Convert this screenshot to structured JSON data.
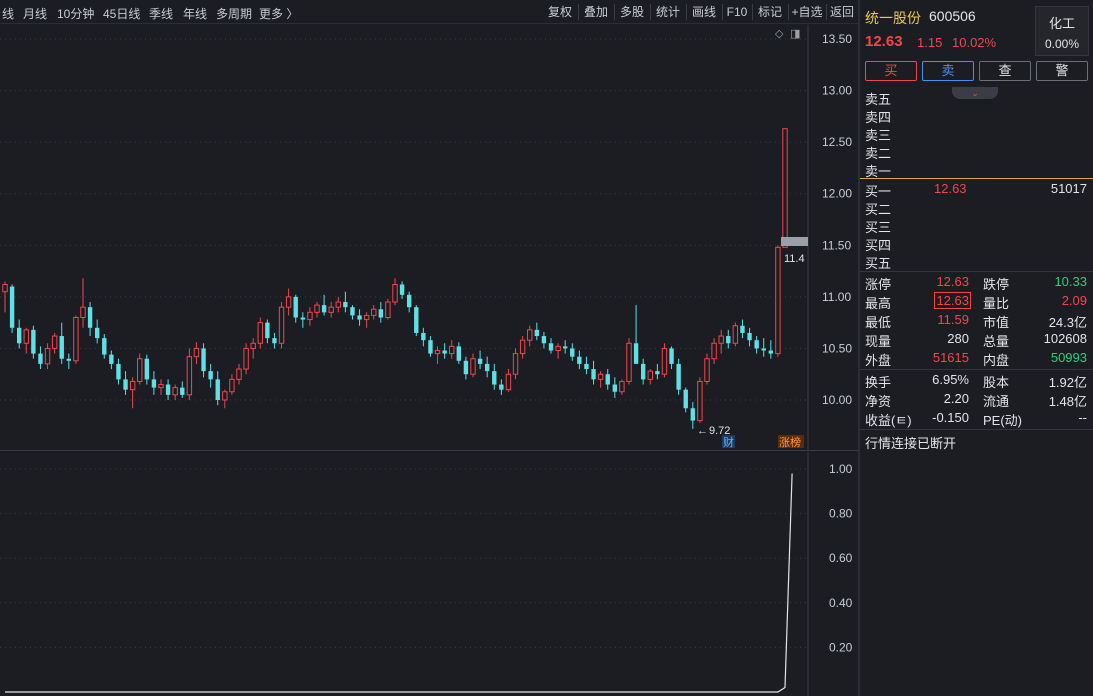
{
  "toolbar": {
    "period_tabs": [
      "线",
      "月线",
      "10分钟",
      "45日线",
      "季线",
      "年线",
      "多周期",
      "更多 〉"
    ],
    "buttons": [
      "复权",
      "叠加",
      "多股",
      "统计",
      "画线",
      "F10",
      "标记",
      "+自选",
      "返回"
    ]
  },
  "chart_icons": {
    "diamond": "◇",
    "toggle": "◨"
  },
  "price_axis": {
    "labels": [
      "13.50",
      "13.00",
      "12.50",
      "12.00",
      "11.50",
      "11.00",
      "10.50",
      "10.00"
    ],
    "current_tag": "11.4",
    "low_marker": "9.72",
    "cai_label": "财",
    "zhangbang_label": "涨榜"
  },
  "volume_axis": {
    "labels": [
      "1.00",
      "0.80",
      "0.60",
      "0.40",
      "0.20"
    ]
  },
  "stock": {
    "name": "统一股份",
    "code": "600506",
    "price": "12.63",
    "change": "1.15",
    "change_pct": "10.02%",
    "sector": "化工",
    "sector_change": "0.00%"
  },
  "trade_buttons": [
    {
      "label": "买",
      "color": "#f0474d",
      "border": "#f0474d"
    },
    {
      "label": "卖",
      "color": "#4d8df0",
      "border": "#4d8df0"
    },
    {
      "label": "查",
      "color": "#e2e4e8",
      "border": "#6a6e77"
    },
    {
      "label": "警",
      "color": "#e2e4e8",
      "border": "#6a6e77"
    }
  ],
  "collapse_icon": "⌄",
  "order_book": {
    "asks": [
      {
        "label": "卖五",
        "price": "",
        "volume": ""
      },
      {
        "label": "卖四",
        "price": "",
        "volume": ""
      },
      {
        "label": "卖三",
        "price": "",
        "volume": ""
      },
      {
        "label": "卖二",
        "price": "",
        "volume": ""
      },
      {
        "label": "卖一",
        "price": "",
        "volume": ""
      }
    ],
    "bids": [
      {
        "label": "买一",
        "price": "12.63",
        "volume": "51017"
      },
      {
        "label": "买二",
        "price": "",
        "volume": ""
      },
      {
        "label": "买三",
        "price": "",
        "volume": ""
      },
      {
        "label": "买四",
        "price": "",
        "volume": ""
      },
      {
        "label": "买五",
        "price": "",
        "volume": ""
      }
    ]
  },
  "quotes": [
    {
      "l1": "涨停",
      "v1": "12.63",
      "c1": "red",
      "l2": "跌停",
      "v2": "10.33",
      "c2": "green"
    },
    {
      "l1": "最高",
      "v1": "12.63",
      "c1": "red",
      "l2": "量比",
      "v2": "2.09",
      "c2": "red"
    },
    {
      "l1": "最低",
      "v1": "11.59",
      "c1": "red",
      "l2": "市值",
      "v2": "24.3亿",
      "c2": "white"
    },
    {
      "l1": "现量",
      "v1": "280",
      "c1": "white",
      "l2": "总量",
      "v2": "102608",
      "c2": "white"
    },
    {
      "l1": "外盘",
      "v1": "51615",
      "c1": "red",
      "l2": "内盘",
      "v2": "50993",
      "c2": "green"
    }
  ],
  "fundamentals": [
    {
      "l1": "换手",
      "v1": "6.95%",
      "l2": "股本",
      "v2": "1.92亿"
    },
    {
      "l1": "净资",
      "v1": "2.20",
      "l2": "流通",
      "v2": "1.48亿"
    },
    {
      "l1": "收益(ㅌ)",
      "v1": "-0.150",
      "l2": "PE(动)",
      "v2": "--"
    }
  ],
  "status": "行情连接已断开",
  "colors": {
    "up": "#f0474d",
    "down": "#5ee0e6",
    "bg": "#1b1d22",
    "axis_text": "#c8ccd4",
    "grid": "#3a3d45"
  },
  "chart_data": {
    "type": "candlestick",
    "y_axis_main": {
      "range": [
        9.72,
        13.5
      ],
      "ticks": [
        13.5,
        13.0,
        12.5,
        12.0,
        11.5,
        11.0,
        10.5,
        10.0
      ]
    },
    "y_axis_sub": {
      "range": [
        0,
        1.0
      ],
      "ticks": [
        1.0,
        0.8,
        0.6,
        0.4,
        0.2
      ]
    },
    "last_close": 12.63,
    "previous_close": 11.48,
    "low_marked": 9.72,
    "candles_ohlc": [
      [
        11.05,
        11.15,
        10.85,
        11.12
      ],
      [
        11.1,
        11.12,
        10.65,
        10.7
      ],
      [
        10.7,
        10.78,
        10.5,
        10.55
      ],
      [
        10.55,
        10.7,
        10.45,
        10.68
      ],
      [
        10.68,
        10.72,
        10.4,
        10.45
      ],
      [
        10.45,
        10.52,
        10.3,
        10.35
      ],
      [
        10.35,
        10.55,
        10.3,
        10.5
      ],
      [
        10.5,
        10.65,
        10.45,
        10.62
      ],
      [
        10.62,
        10.75,
        10.35,
        10.4
      ],
      [
        10.4,
        10.45,
        10.3,
        10.38
      ],
      [
        10.38,
        10.82,
        10.35,
        10.8
      ],
      [
        10.8,
        11.18,
        10.7,
        10.9
      ],
      [
        10.9,
        10.95,
        10.62,
        10.7
      ],
      [
        10.7,
        10.78,
        10.55,
        10.6
      ],
      [
        10.6,
        10.64,
        10.4,
        10.44
      ],
      [
        10.44,
        10.48,
        10.3,
        10.35
      ],
      [
        10.35,
        10.4,
        10.15,
        10.2
      ],
      [
        10.2,
        10.28,
        10.05,
        10.1
      ],
      [
        10.1,
        10.22,
        9.92,
        10.18
      ],
      [
        10.18,
        10.45,
        10.15,
        10.4
      ],
      [
        10.4,
        10.44,
        10.15,
        10.2
      ],
      [
        10.2,
        10.28,
        10.05,
        10.12
      ],
      [
        10.12,
        10.2,
        10.05,
        10.15
      ],
      [
        10.15,
        10.2,
        10.0,
        10.05
      ],
      [
        10.05,
        10.15,
        10.0,
        10.12
      ],
      [
        10.12,
        10.18,
        10.02,
        10.05
      ],
      [
        10.05,
        10.5,
        10.0,
        10.42
      ],
      [
        10.42,
        10.56,
        10.35,
        10.5
      ],
      [
        10.5,
        10.55,
        10.22,
        10.28
      ],
      [
        10.28,
        10.35,
        10.12,
        10.2
      ],
      [
        10.2,
        10.28,
        9.95,
        10.0
      ],
      [
        10.0,
        10.1,
        9.92,
        10.08
      ],
      [
        10.08,
        10.25,
        10.05,
        10.2
      ],
      [
        10.2,
        10.35,
        10.15,
        10.3
      ],
      [
        10.3,
        10.55,
        10.25,
        10.5
      ],
      [
        10.5,
        10.6,
        10.4,
        10.55
      ],
      [
        10.55,
        10.8,
        10.5,
        10.75
      ],
      [
        10.75,
        10.78,
        10.55,
        10.6
      ],
      [
        10.6,
        10.65,
        10.5,
        10.55
      ],
      [
        10.55,
        10.95,
        10.5,
        10.9
      ],
      [
        10.9,
        11.08,
        10.82,
        11.0
      ],
      [
        11.0,
        11.02,
        10.75,
        10.8
      ],
      [
        10.8,
        10.85,
        10.7,
        10.78
      ],
      [
        10.78,
        10.9,
        10.72,
        10.85
      ],
      [
        10.85,
        10.95,
        10.8,
        10.92
      ],
      [
        10.92,
        11.02,
        10.82,
        10.85
      ],
      [
        10.85,
        10.95,
        10.8,
        10.9
      ],
      [
        10.9,
        11.0,
        10.85,
        10.95
      ],
      [
        10.95,
        11.05,
        10.85,
        10.9
      ],
      [
        10.9,
        10.92,
        10.78,
        10.82
      ],
      [
        10.82,
        10.88,
        10.72,
        10.78
      ],
      [
        10.78,
        10.85,
        10.7,
        10.82
      ],
      [
        10.82,
        10.92,
        10.78,
        10.88
      ],
      [
        10.88,
        10.95,
        10.75,
        10.8
      ],
      [
        10.8,
        10.98,
        10.78,
        10.95
      ],
      [
        10.95,
        11.18,
        10.92,
        11.12
      ],
      [
        11.12,
        11.15,
        10.98,
        11.02
      ],
      [
        11.02,
        11.05,
        10.85,
        10.9
      ],
      [
        10.9,
        10.92,
        10.62,
        10.65
      ],
      [
        10.65,
        10.7,
        10.52,
        10.58
      ],
      [
        10.58,
        10.62,
        10.42,
        10.45
      ],
      [
        10.45,
        10.52,
        10.35,
        10.48
      ],
      [
        10.48,
        10.55,
        10.4,
        10.45
      ],
      [
        10.45,
        10.58,
        10.4,
        10.52
      ],
      [
        10.52,
        10.56,
        10.35,
        10.38
      ],
      [
        10.38,
        10.42,
        10.2,
        10.25
      ],
      [
        10.25,
        10.45,
        10.22,
        10.4
      ],
      [
        10.4,
        10.48,
        10.3,
        10.35
      ],
      [
        10.35,
        10.42,
        10.22,
        10.28
      ],
      [
        10.28,
        10.35,
        10.1,
        10.15
      ],
      [
        10.15,
        10.2,
        10.05,
        10.1
      ],
      [
        10.1,
        10.3,
        10.08,
        10.25
      ],
      [
        10.25,
        10.5,
        10.2,
        10.45
      ],
      [
        10.45,
        10.62,
        10.4,
        10.58
      ],
      [
        10.58,
        10.72,
        10.52,
        10.68
      ],
      [
        10.68,
        10.75,
        10.58,
        10.62
      ],
      [
        10.62,
        10.66,
        10.5,
        10.55
      ],
      [
        10.55,
        10.6,
        10.45,
        10.48
      ],
      [
        10.48,
        10.55,
        10.4,
        10.52
      ],
      [
        10.52,
        10.58,
        10.45,
        10.5
      ],
      [
        10.5,
        10.55,
        10.38,
        10.42
      ],
      [
        10.42,
        10.48,
        10.3,
        10.35
      ],
      [
        10.35,
        10.42,
        10.25,
        10.3
      ],
      [
        10.3,
        10.38,
        10.15,
        10.2
      ],
      [
        10.2,
        10.28,
        10.12,
        10.25
      ],
      [
        10.25,
        10.3,
        10.1,
        10.15
      ],
      [
        10.15,
        10.22,
        10.02,
        10.08
      ],
      [
        10.08,
        10.2,
        10.05,
        10.18
      ],
      [
        10.18,
        10.6,
        10.15,
        10.55
      ],
      [
        10.55,
        10.92,
        10.5,
        10.35
      ],
      [
        10.35,
        10.4,
        10.15,
        10.2
      ],
      [
        10.2,
        10.3,
        10.15,
        10.28
      ],
      [
        10.28,
        10.35,
        10.2,
        10.25
      ],
      [
        10.25,
        10.55,
        10.22,
        10.5
      ],
      [
        10.5,
        10.52,
        10.3,
        10.35
      ],
      [
        10.35,
        10.4,
        10.05,
        10.1
      ],
      [
        10.1,
        10.12,
        9.88,
        9.92
      ],
      [
        9.92,
        9.98,
        9.72,
        9.8
      ],
      [
        9.8,
        10.22,
        9.78,
        10.18
      ],
      [
        10.18,
        10.45,
        10.15,
        10.4
      ],
      [
        10.4,
        10.6,
        10.35,
        10.55
      ],
      [
        10.55,
        10.68,
        10.45,
        10.62
      ],
      [
        10.62,
        10.68,
        10.5,
        10.55
      ],
      [
        10.55,
        10.75,
        10.52,
        10.72
      ],
      [
        10.72,
        10.78,
        10.6,
        10.65
      ],
      [
        10.65,
        10.7,
        10.52,
        10.58
      ],
      [
        10.58,
        10.62,
        10.45,
        10.5
      ],
      [
        10.5,
        10.6,
        10.42,
        10.48
      ],
      [
        10.48,
        10.58,
        10.4,
        10.45
      ],
      [
        10.45,
        11.5,
        10.42,
        11.48
      ],
      [
        11.48,
        12.63,
        11.48,
        12.63
      ]
    ],
    "volume_line": [
      0,
      0,
      0,
      0,
      0,
      0,
      0,
      0,
      0,
      0,
      0,
      0,
      0,
      0,
      0,
      0,
      0,
      0,
      0,
      0,
      0,
      0,
      0,
      0,
      0,
      0,
      0,
      0,
      0,
      0,
      0,
      0,
      0,
      0,
      0,
      0,
      0,
      0,
      0,
      0,
      0,
      0,
      0,
      0,
      0,
      0,
      0,
      0,
      0,
      0,
      0,
      0,
      0,
      0,
      0,
      0,
      0,
      0,
      0,
      0,
      0,
      0,
      0,
      0,
      0,
      0,
      0,
      0,
      0,
      0,
      0,
      0,
      0,
      0,
      0,
      0,
      0,
      0,
      0,
      0,
      0,
      0,
      0,
      0,
      0,
      0,
      0,
      0,
      0,
      0,
      0,
      0,
      0,
      0,
      0,
      0,
      0,
      0,
      0,
      0,
      0,
      0,
      0,
      0,
      0,
      0,
      0,
      0,
      0,
      0,
      0.02,
      0.98
    ]
  }
}
